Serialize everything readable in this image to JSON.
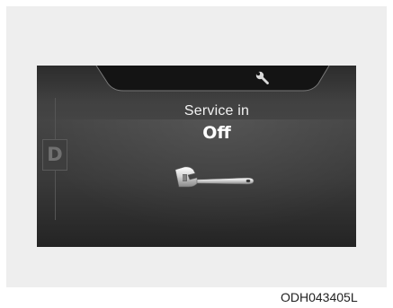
{
  "display": {
    "title": "Service in",
    "value": "Off",
    "gear": "D",
    "header_icon": "wrench-icon",
    "main_icon": "wrench-icon"
  },
  "caption": "ODH043405L",
  "colors": {
    "background": "#eeeeee",
    "screen": "#3b3b3b",
    "text": "#ffffff"
  }
}
